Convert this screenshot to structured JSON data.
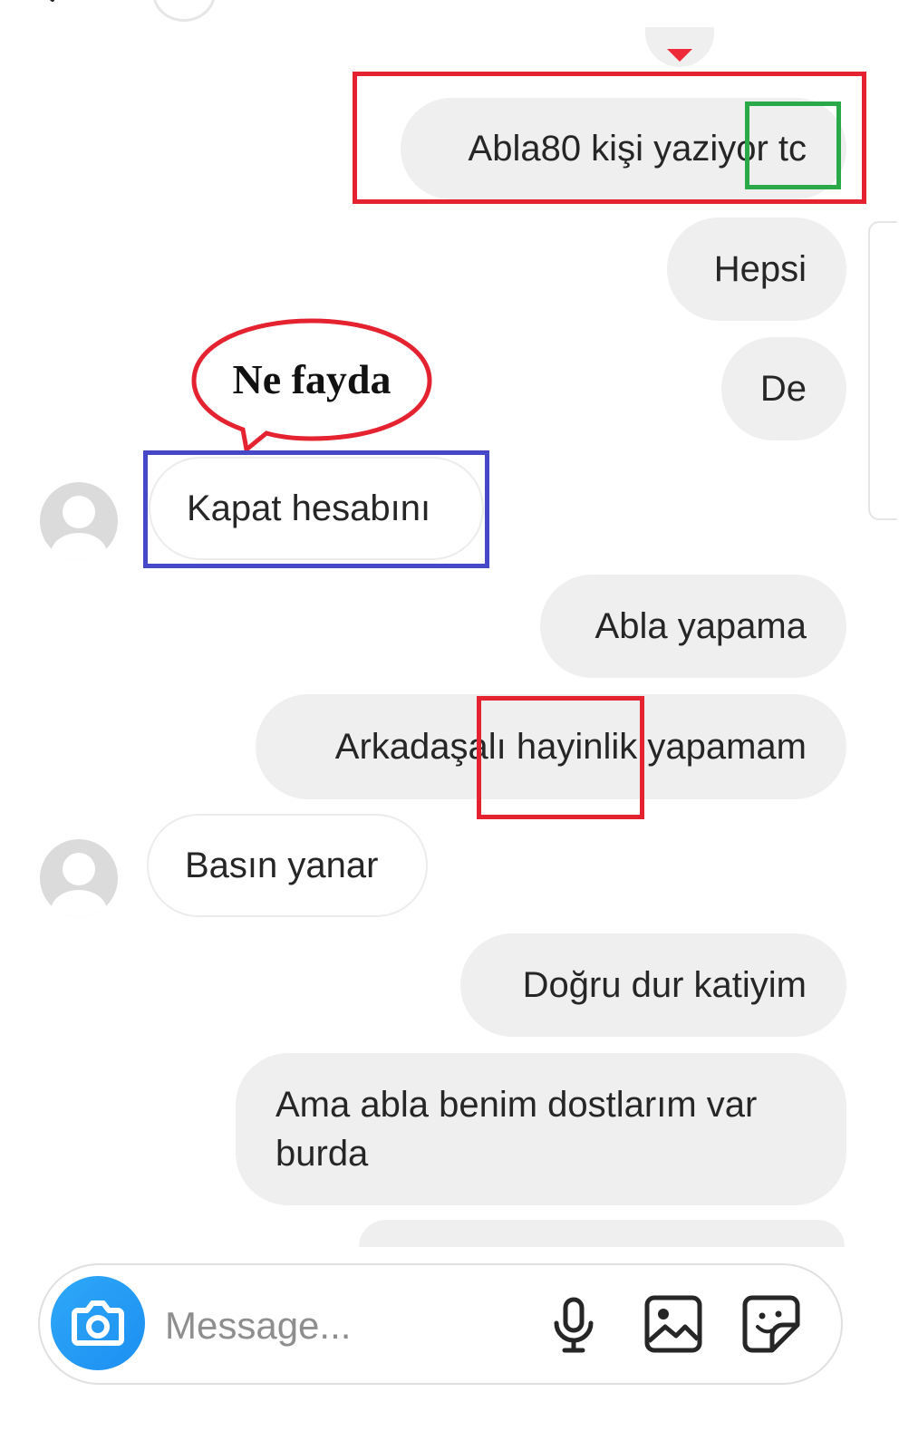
{
  "messages": [
    {
      "id": "m1",
      "side": "outgoing",
      "text": "Abla80 kişi yaziyor tc"
    },
    {
      "id": "m2",
      "side": "outgoing",
      "text": "Hepsi"
    },
    {
      "id": "m3",
      "side": "outgoing",
      "text": "De"
    },
    {
      "id": "m4",
      "side": "incoming",
      "text": "Kapat hesabını"
    },
    {
      "id": "m5",
      "side": "outgoing",
      "text": "Abla yapama"
    },
    {
      "id": "m6",
      "side": "outgoing",
      "text": "Arkadaşalı hayinlik yapamam"
    },
    {
      "id": "m7",
      "side": "incoming",
      "text": "Basın yanar"
    },
    {
      "id": "m8",
      "side": "outgoing",
      "text": "Doğru dur katiyim"
    },
    {
      "id": "m9",
      "side": "outgoing",
      "text": "Ama abla benim dostlarım var burda"
    }
  ],
  "annotation": {
    "speech_text": "Ne fayda"
  },
  "composer": {
    "placeholder": "Message..."
  },
  "colors": {
    "outgoing_bubble": "#efefef",
    "incoming_border": "#ececec",
    "camera": "#1d8ff1",
    "annotation_red": "#e42230",
    "annotation_green": "#2aa948",
    "annotation_blue": "#4648c8",
    "reaction_heart": "#ef2a38"
  },
  "icons": [
    "back-arrow-icon",
    "camera-icon",
    "microphone-icon",
    "gallery-icon",
    "sticker-icon",
    "heart-icon"
  ]
}
